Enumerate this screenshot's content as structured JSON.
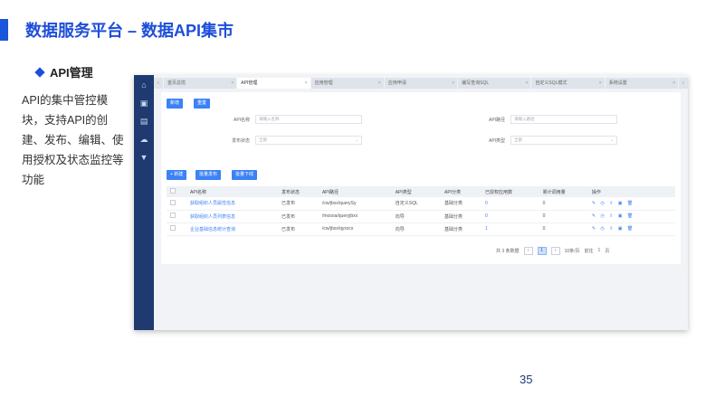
{
  "slide": {
    "title": "数据服务平台 – 数据API集市",
    "section": "API管理",
    "description": "API的集中管控模块，支持API的创建、发布、编辑、使用授权及状态监控等功能",
    "page_number": "35"
  },
  "app": {
    "tabs": [
      {
        "label": "首页总揽",
        "active": false
      },
      {
        "label": "API管理",
        "active": true
      },
      {
        "label": "应用管理",
        "active": false
      },
      {
        "label": "应用申请",
        "active": false
      },
      {
        "label": "编写查询SQL",
        "active": false
      },
      {
        "label": "自定义SQL模式",
        "active": false
      },
      {
        "label": "系统设置",
        "active": false
      }
    ],
    "filter": {
      "add_label": "新增",
      "reset_label": "重置",
      "api_name_label": "API名称",
      "api_name_placeholder": "请输入名称",
      "api_path_label": "API路径",
      "api_path_placeholder": "请输入路径",
      "publish_status_label": "发布状态",
      "publish_status_value": "全部",
      "api_type_label": "API类型",
      "api_type_value": "全部"
    },
    "actions": {
      "new_label": "+ 新建",
      "batch_publish_label": "批量发布",
      "batch_offline_label": "批量下线"
    },
    "table": {
      "headers": [
        "API名称",
        "发布状态",
        "API路径",
        "API类型",
        "API分类",
        "已授权应用数",
        "累计调用量",
        "操作"
      ],
      "rows": [
        [
          "获取组织人员属性信息",
          "已发布",
          "/cw/jbxx/querySy",
          "自定义SQL",
          "基础分类",
          "0",
          "0"
        ],
        [
          "获取组织人员列表信息",
          "已发布",
          "/mosoa/queryjbxx",
          "向导",
          "基础分类",
          "0",
          "0"
        ],
        [
          "企业基础信息统计查询",
          "已发布",
          "/cw/jbxx/qyxxcx",
          "向导",
          "基础分类",
          "1",
          "0"
        ]
      ],
      "ops": "✎ ◷ ⇪ ▣ 🗑"
    },
    "pagination": {
      "total": "共 3 条数据",
      "prev": "‹",
      "current": "1",
      "next": "›",
      "page_size": "10条/页",
      "goto": "前往",
      "goto_page": "1",
      "unit": "页"
    }
  }
}
